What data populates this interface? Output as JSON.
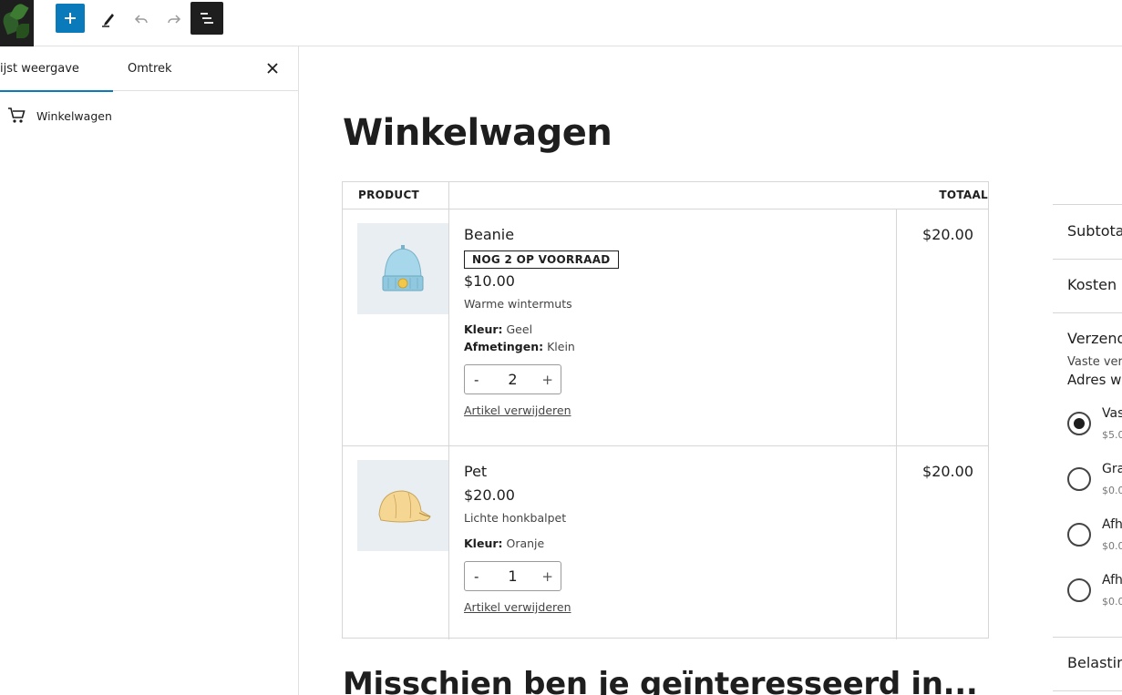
{
  "toolbar": {
    "add_label": "+",
    "list_view_label": "Lijst weergave"
  },
  "sidebar": {
    "tabs": [
      "ijst weergave",
      "Omtrek"
    ],
    "close_label": "×",
    "items": [
      {
        "label": "Winkelwagen"
      }
    ]
  },
  "page": {
    "title": "Winkelwagen",
    "related_title": "Misschien ben je geïnteresseerd in..."
  },
  "cart": {
    "headers": {
      "product": "PRODUCT",
      "total": "TOTAAL"
    },
    "items": [
      {
        "name": "Beanie",
        "stock_badge": "NOG 2 OP VOORRAAD",
        "price": "$10.00",
        "description": "Warme wintermuts",
        "meta": [
          {
            "key": "Kleur:",
            "value": "Geel"
          },
          {
            "key": "Afmetingen:",
            "value": "Klein"
          }
        ],
        "quantity": "2",
        "minus": "-",
        "plus": "+",
        "remove_label": "Artikel verwijderen",
        "total": "$20.00"
      },
      {
        "name": "Pet",
        "price": "$20.00",
        "description": "Lichte honkbalpet",
        "meta": [
          {
            "key": "Kleur:",
            "value": "Oranje"
          }
        ],
        "quantity": "1",
        "minus": "-",
        "plus": "+",
        "remove_label": "Artikel verwijderen",
        "total": "$20.00"
      }
    ]
  },
  "totals": {
    "subtotal": "Subtota",
    "fees": "Kosten",
    "shipping": "Verzend",
    "shipping_note_1": "Vaste ver",
    "shipping_note_2": "Adres w",
    "options": [
      {
        "label": "Vas",
        "price": "$5.0"
      },
      {
        "label": "Gra",
        "price": "$0.0"
      },
      {
        "label": "Afh",
        "price": "$0.0"
      },
      {
        "label": "Afh",
        "price": "$0.0"
      }
    ],
    "taxes": "Belastin"
  },
  "colors": {
    "accent": "#0a7aba",
    "dark": "#1e1e1e",
    "border": "#d6d6d6",
    "thumb_bg": "#e8eef2"
  }
}
